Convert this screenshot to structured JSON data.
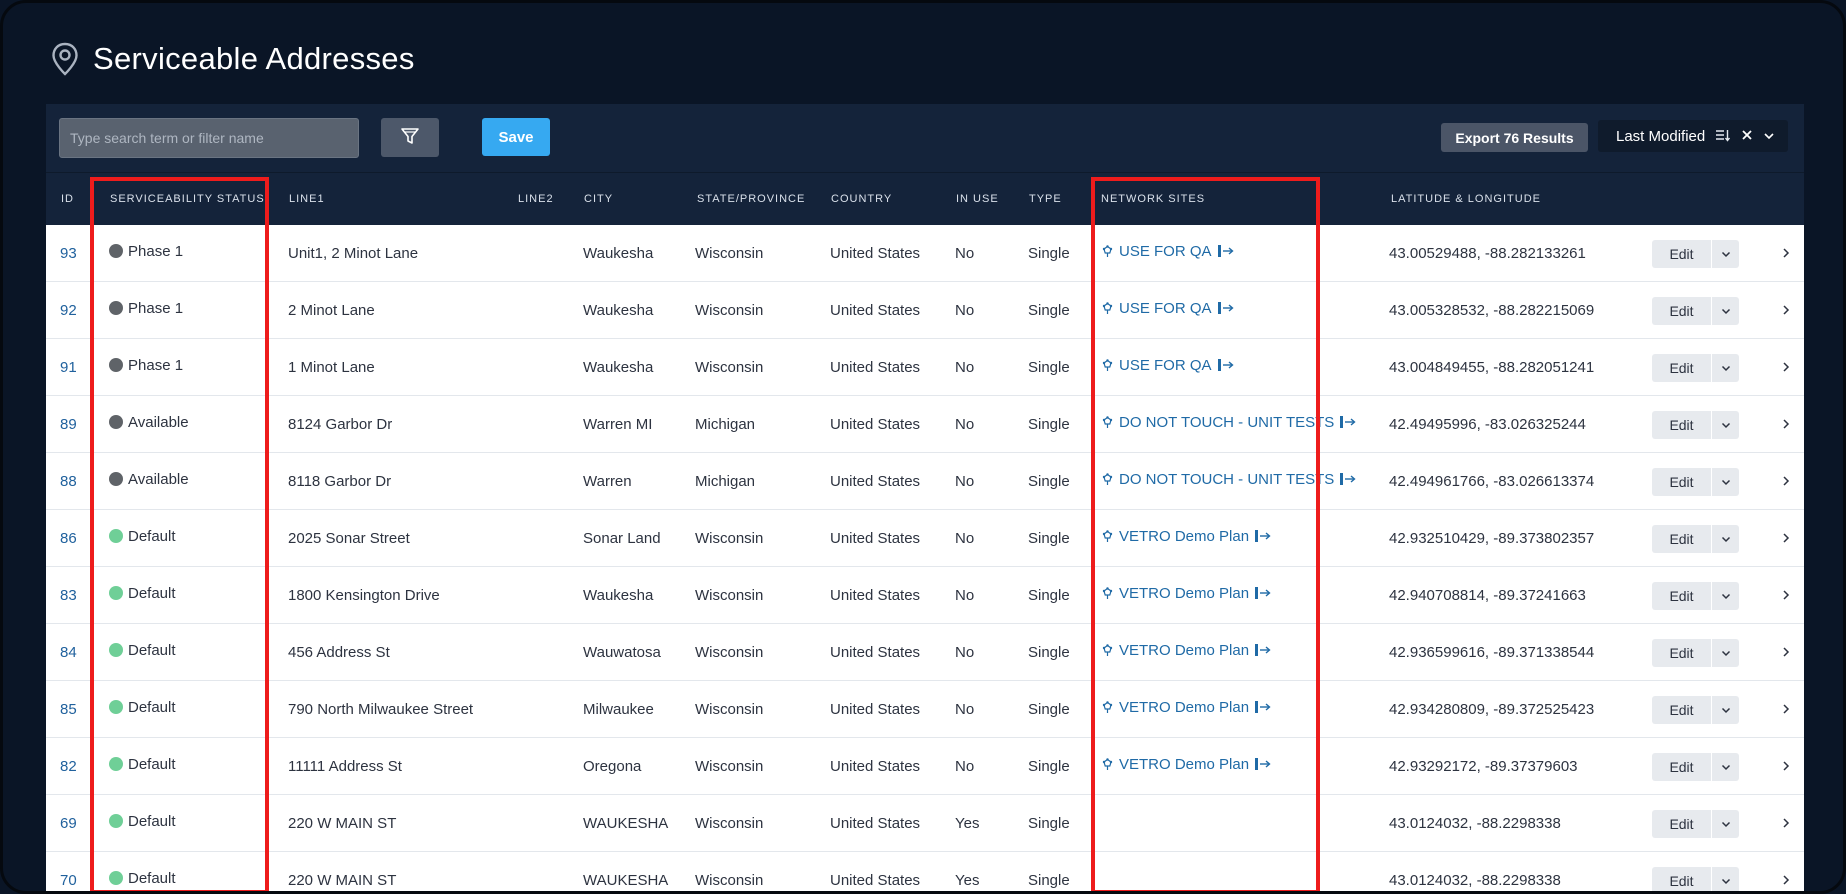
{
  "page": {
    "title": "Serviceable Addresses",
    "icon": "map-pin-icon"
  },
  "toolbar": {
    "search_placeholder": "Type search term or filter name",
    "filter_icon": "filter-icon",
    "save_label": "Save",
    "export_label": "Export 76 Results",
    "sort_label": "Last Modified",
    "sort_icons": [
      "sort-descending-icon",
      "clear-icon",
      "chevron-down-icon"
    ]
  },
  "columns": {
    "id": "ID",
    "status": "SERVICEABILITY STATUS",
    "line1": "LINE1",
    "line2": "LINE2",
    "city": "CITY",
    "state": "STATE/PROVINCE",
    "country": "COUNTRY",
    "in_use": "IN USE",
    "type": "TYPE",
    "network_sites": "NETWORK SITES",
    "latlng": "LATITUDE & LONGITUDE"
  },
  "row_action": {
    "edit_label": "Edit"
  },
  "status_colors": {
    "Phase 1": "#5f6368",
    "Available": "#5f6368",
    "Default": "#6fcf97"
  },
  "accent_colors": {
    "highlight": "#ee1c1c",
    "link": "#1f6aa6",
    "save": "#36a9f1"
  },
  "rows": [
    {
      "id": "93",
      "status": "Phase 1",
      "line1": "Unit1, 2 Minot Lane",
      "line2": "",
      "city": "Waukesha",
      "state": "Wisconsin",
      "country": "United States",
      "in_use": "No",
      "type": "Single",
      "site": "USE FOR QA",
      "latlng": "43.00529488, -88.282133261"
    },
    {
      "id": "92",
      "status": "Phase 1",
      "line1": "2 Minot Lane",
      "line2": "",
      "city": "Waukesha",
      "state": "Wisconsin",
      "country": "United States",
      "in_use": "No",
      "type": "Single",
      "site": "USE FOR QA",
      "latlng": "43.005328532, -88.282215069"
    },
    {
      "id": "91",
      "status": "Phase 1",
      "line1": "1 Minot Lane",
      "line2": "",
      "city": "Waukesha",
      "state": "Wisconsin",
      "country": "United States",
      "in_use": "No",
      "type": "Single",
      "site": "USE FOR QA",
      "latlng": "43.004849455, -88.282051241"
    },
    {
      "id": "89",
      "status": "Available",
      "line1": "8124 Garbor Dr",
      "line2": "",
      "city": "Warren MI",
      "state": "Michigan",
      "country": "United States",
      "in_use": "No",
      "type": "Single",
      "site": "DO NOT TOUCH - UNIT TESTS",
      "latlng": "42.49495996, -83.026325244"
    },
    {
      "id": "88",
      "status": "Available",
      "line1": "8118 Garbor Dr",
      "line2": "",
      "city": "Warren",
      "state": "Michigan",
      "country": "United States",
      "in_use": "No",
      "type": "Single",
      "site": "DO NOT TOUCH - UNIT TESTS",
      "latlng": "42.494961766, -83.026613374"
    },
    {
      "id": "86",
      "status": "Default",
      "line1": "2025 Sonar Street",
      "line2": "",
      "city": "Sonar Land",
      "state": "Wisconsin",
      "country": "United States",
      "in_use": "No",
      "type": "Single",
      "site": "VETRO Demo Plan",
      "latlng": "42.932510429, -89.373802357"
    },
    {
      "id": "83",
      "status": "Default",
      "line1": "1800 Kensington Drive",
      "line2": "",
      "city": "Waukesha",
      "state": "Wisconsin",
      "country": "United States",
      "in_use": "No",
      "type": "Single",
      "site": "VETRO Demo Plan",
      "latlng": "42.940708814, -89.37241663"
    },
    {
      "id": "84",
      "status": "Default",
      "line1": "456 Address St",
      "line2": "",
      "city": "Wauwatosa",
      "state": "Wisconsin",
      "country": "United States",
      "in_use": "No",
      "type": "Single",
      "site": "VETRO Demo Plan",
      "latlng": "42.936599616, -89.371338544"
    },
    {
      "id": "85",
      "status": "Default",
      "line1": "790 North Milwaukee Street",
      "line2": "",
      "city": "Milwaukee",
      "state": "Wisconsin",
      "country": "United States",
      "in_use": "No",
      "type": "Single",
      "site": "VETRO Demo Plan",
      "latlng": "42.934280809, -89.372525423"
    },
    {
      "id": "82",
      "status": "Default",
      "line1": "11111 Address St",
      "line2": "",
      "city": "Oregona",
      "state": "Wisconsin",
      "country": "United States",
      "in_use": "No",
      "type": "Single",
      "site": "VETRO Demo Plan",
      "latlng": "42.93292172, -89.37379603"
    },
    {
      "id": "69",
      "status": "Default",
      "line1": "220 W MAIN ST",
      "line2": "",
      "city": "WAUKESHA",
      "state": "Wisconsin",
      "country": "United States",
      "in_use": "Yes",
      "type": "Single",
      "site": "",
      "latlng": "43.0124032, -88.2298338"
    },
    {
      "id": "70",
      "status": "Default",
      "line1": "220 W MAIN ST",
      "line2": "",
      "city": "WAUKESHA",
      "state": "Wisconsin",
      "country": "United States",
      "in_use": "Yes",
      "type": "Single",
      "site": "",
      "latlng": "43.0124032, -88.2298338"
    }
  ]
}
